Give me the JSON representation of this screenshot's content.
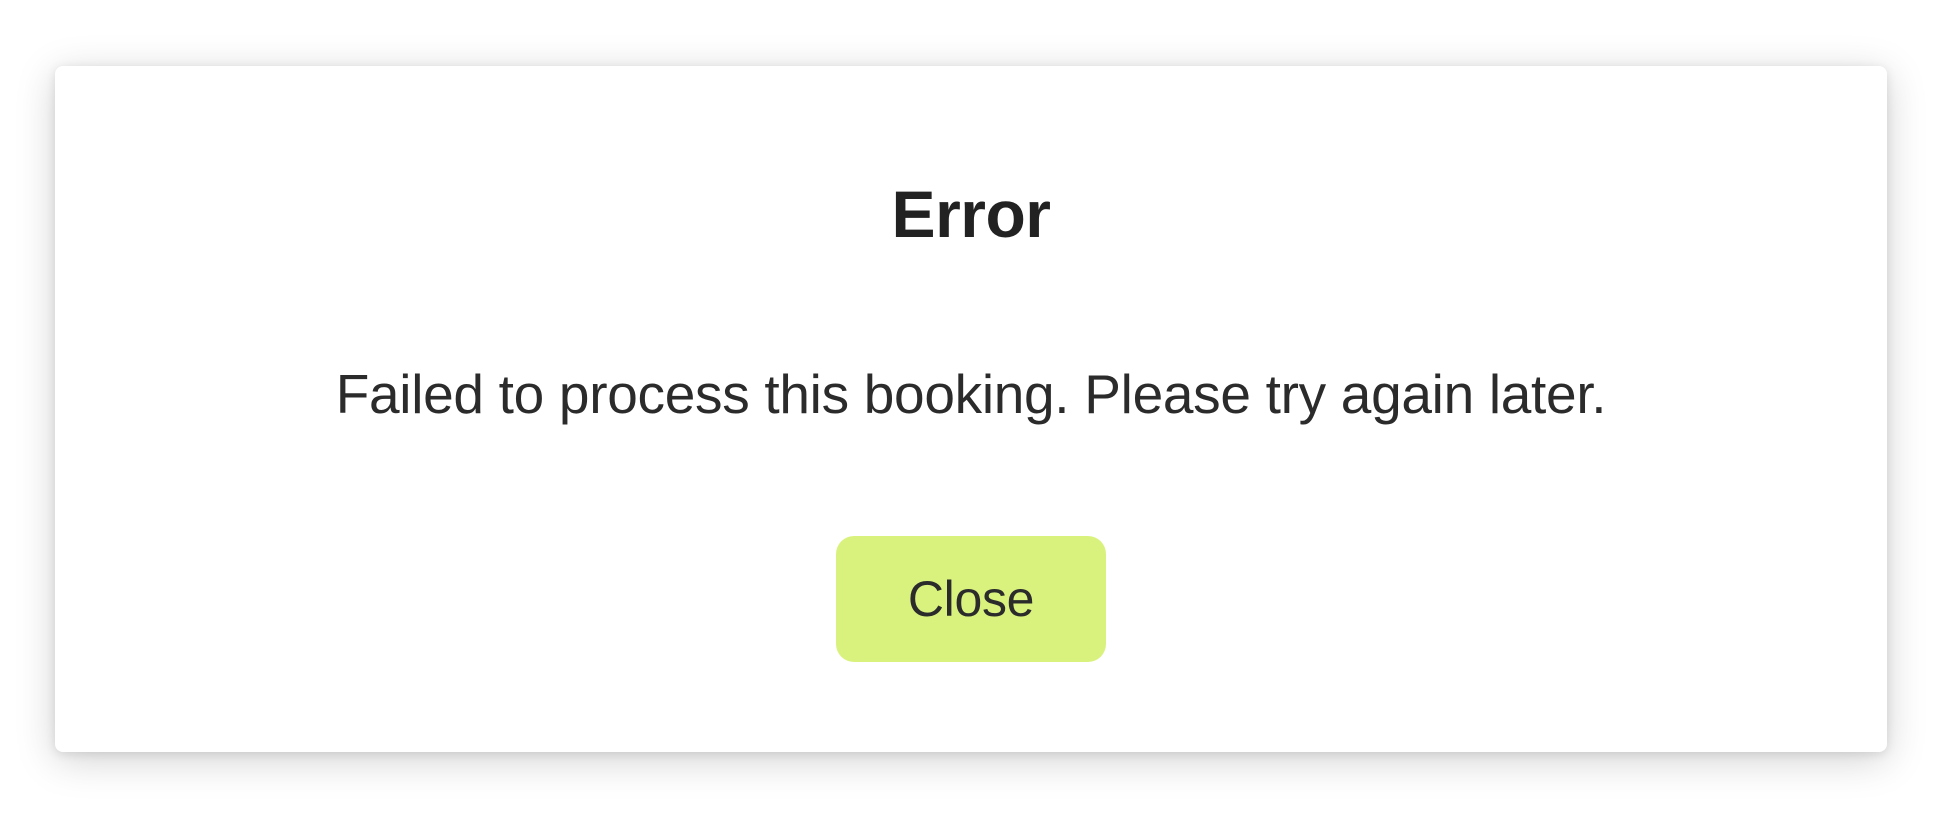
{
  "modal": {
    "title": "Error",
    "message": "Failed to process this booking. Please try again later.",
    "close_label": "Close"
  }
}
